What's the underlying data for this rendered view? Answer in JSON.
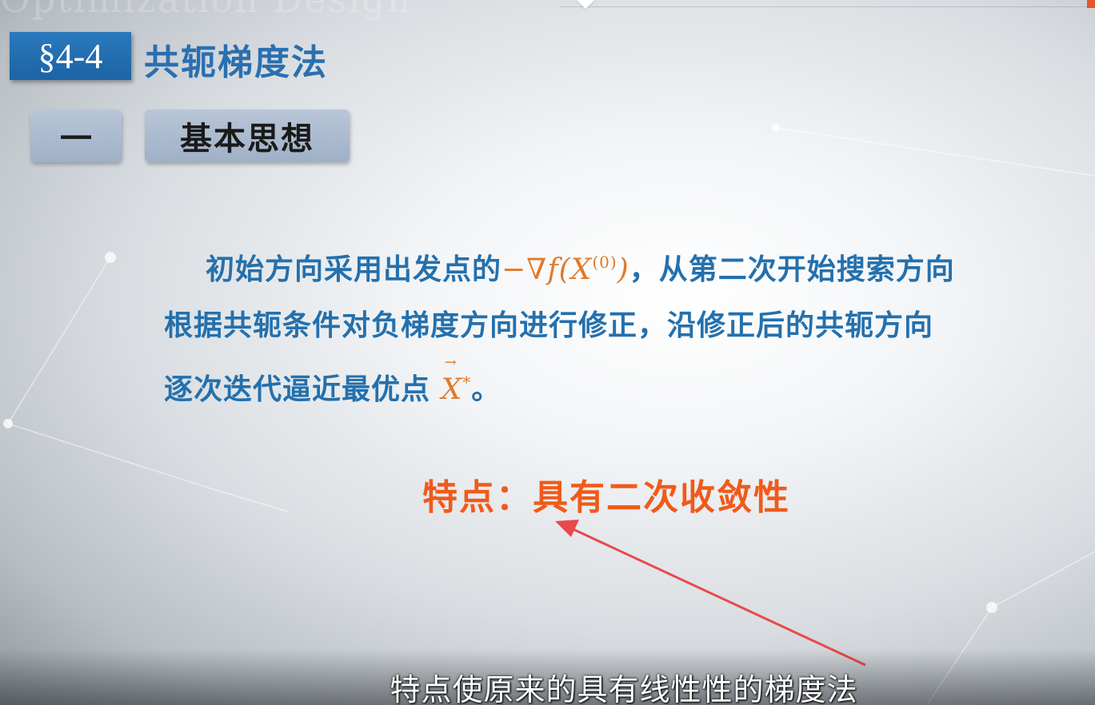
{
  "slide": {
    "section_number": "§4-4",
    "section_title": "共轭梯度法",
    "sub_number": "一",
    "sub_title": "基本思想",
    "paragraph": {
      "part1": "初始方向采用出发点的",
      "math1": "−∇f(X",
      "math1_sup": "(0)",
      "math1_close": ")",
      "part2": "，从第二次开始搜索方向",
      "line2": "根据共轭条件对负梯度方向进行修正，沿修正后的共轭方向",
      "line3_text": "逐次迭代逼近最优点",
      "math2": "X",
      "math2_sup": "*",
      "line3_end": "。"
    },
    "feature": "特点：具有二次收敛性",
    "accent_color": "#f05a1a",
    "text_color": "#2470ad",
    "badge_color": "#1d63a4"
  },
  "video": {
    "subtitle": "特点使原来的具有线性性的梯度法"
  },
  "annotation": {
    "arrow_color": "#e84a4a"
  }
}
